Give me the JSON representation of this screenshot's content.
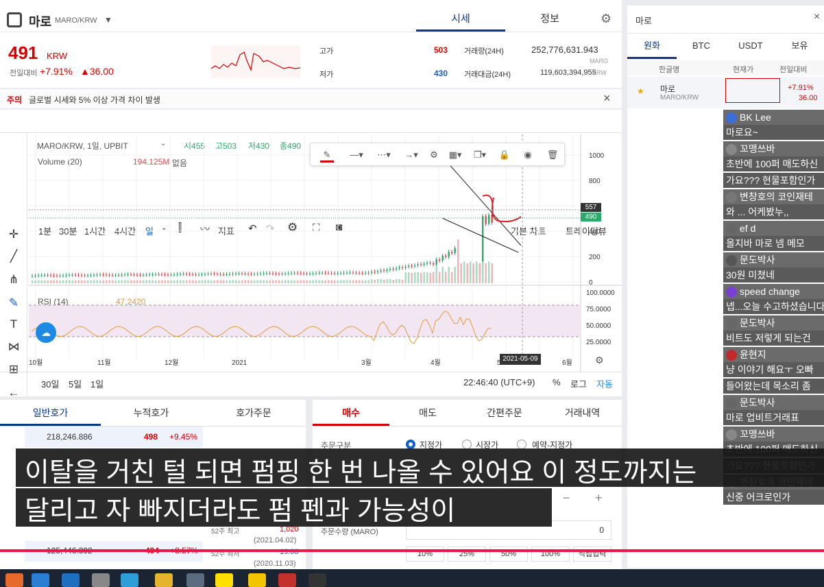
{
  "header": {
    "coin_name": "마로",
    "pair": "MARO/KRW",
    "tab_price": "시세",
    "tab_info": "정보",
    "close_icon": "×"
  },
  "price": {
    "value": "491",
    "unit": "KRW",
    "change_label": "전일대비",
    "change_pct": "+7.91%",
    "change_abs": "▲36.00"
  },
  "stats": {
    "high_label": "고가",
    "high": "503",
    "low_label": "저가",
    "low": "430",
    "vol_label": "거래량(24H)",
    "vol": "252,776,631.943",
    "vol_unit": "MARO",
    "amt_label": "거래대금(24H)",
    "amt": "119,603,394,955",
    "amt_unit": "KRW"
  },
  "notice": {
    "tag": "주의",
    "text": "글로벌 시세와 5% 이상 가격 차이 발생",
    "close": "×"
  },
  "toolbar": {
    "i1m": "1분",
    "i30m": "30분",
    "i1h": "1시간",
    "i4h": "4시간",
    "iday": "일",
    "indicator": "지표",
    "basic_chart": "기본 차트",
    "trading_view": "트레이딩뷰"
  },
  "legend": {
    "symbol": "MARO/KRW, 1일, UPBIT",
    "o": "시455",
    "h": "고503",
    "l": "저430",
    "c": "종490",
    "volume": "Volume (20)",
    "vol_val": "194.125M",
    "vol_extra": "없음",
    "rsi": "RSI (14)",
    "rsi_val": "47.2420"
  },
  "axes": {
    "price_ticks": [
      "1000",
      "800",
      "600",
      "400",
      "200",
      "0"
    ],
    "rsi_ticks": [
      "100.0000",
      "75.0000",
      "50.0000",
      "25.0000"
    ],
    "x_ticks": [
      "10월",
      "11월",
      "12월",
      "2021",
      "3월",
      "4월",
      "5",
      "6월"
    ],
    "crosshair_date": "2021-05-09",
    "price_tag": "557",
    "last_tag": "490"
  },
  "footer": {
    "r30d": "30일",
    "r5d": "5일",
    "r1d": "1일",
    "time": "22:46:40 (UTC+9)",
    "pct": "%",
    "log": "로그",
    "auto": "자동"
  },
  "orderbook": {
    "tabs": [
      "일반호가",
      "누적호가",
      "호가주문"
    ],
    "rows": [
      {
        "qty": "218,246.886",
        "price": "498",
        "pct": "+9.45%"
      },
      {
        "qty": "125,446.392",
        "price": "494",
        "pct": "+8.57%"
      }
    ],
    "hist": [
      {
        "label": "52주 최고",
        "val": "1,020",
        "date": "(2021.04.02)"
      },
      {
        "label": "52주 최저",
        "val": "19.00",
        "date": "(2020.11.03)"
      }
    ]
  },
  "order": {
    "tabs": [
      "매수",
      "매도",
      "간편주문",
      "거래내역"
    ],
    "type_label": "주문구분",
    "type_opts": [
      "지정가",
      "시장가",
      "예약-지정가"
    ],
    "qty_label": "주문수량 (MARO)",
    "qty_val": "0",
    "pct_btns": [
      "10%",
      "25%",
      "50%",
      "100%",
      "직접입력"
    ],
    "minus": "−",
    "plus": "+"
  },
  "right": {
    "title": "마로",
    "close": "×",
    "tabs": [
      "원화",
      "BTC",
      "USDT",
      "보유"
    ],
    "cols": [
      "한글명",
      "현재가",
      "전일대비"
    ],
    "row": {
      "name": "마로",
      "pair": "MARO/KRW",
      "pct": "+7.91%",
      "abs": "36.00"
    }
  },
  "chat": [
    {
      "user": "BK Lee",
      "msg": "마로요~"
    },
    {
      "user": "꼬맹쓰바",
      "msg": "초반에 100퍼 매도하신"
    },
    {
      "user": "",
      "msg": "가요??? 현물포함인가"
    },
    {
      "user": "변창호의 코인재테",
      "msg": "와 ... 어케봤누,,"
    },
    {
      "user": "ef d",
      "msg": "올지바 마로 넴 메모"
    },
    {
      "user": "문도박사",
      "msg": "30원 미쳤네"
    },
    {
      "user": "speed change",
      "msg": "넵...오늘 수고하셨습니다"
    },
    {
      "user": "문도박사",
      "msg": "비트도 저렇게 되는건"
    },
    {
      "user": "윤현지",
      "msg": "냥 이야기 해요ㅜ 오빠"
    },
    {
      "user": "",
      "msg": "들어왔는데 목소리 좀"
    },
    {
      "user": "문도박사",
      "msg": "마로 업비트거래표"
    },
    {
      "user": "꼬맹쓰바",
      "msg": "초반에 100퍼 매도하신"
    },
    {
      "user": "",
      "msg": "가요??? 현물포함인가"
    },
    {
      "user": "변창호의 코인재테",
      "msg": "신중 어크로인가"
    }
  ],
  "subtitle": {
    "line1": "이탈을 거친 털 되면 펌핑 한 번 나올 수 있어요 이 정도까지는",
    "line2": "달리고 자 빠지더라도 펌 펜과 가능성이"
  },
  "colors": {
    "up": "#d60000",
    "down": "#1261c4",
    "candle_up": "#2ea86b",
    "candle_down": "#e0494f",
    "progress": "#e8174a"
  }
}
